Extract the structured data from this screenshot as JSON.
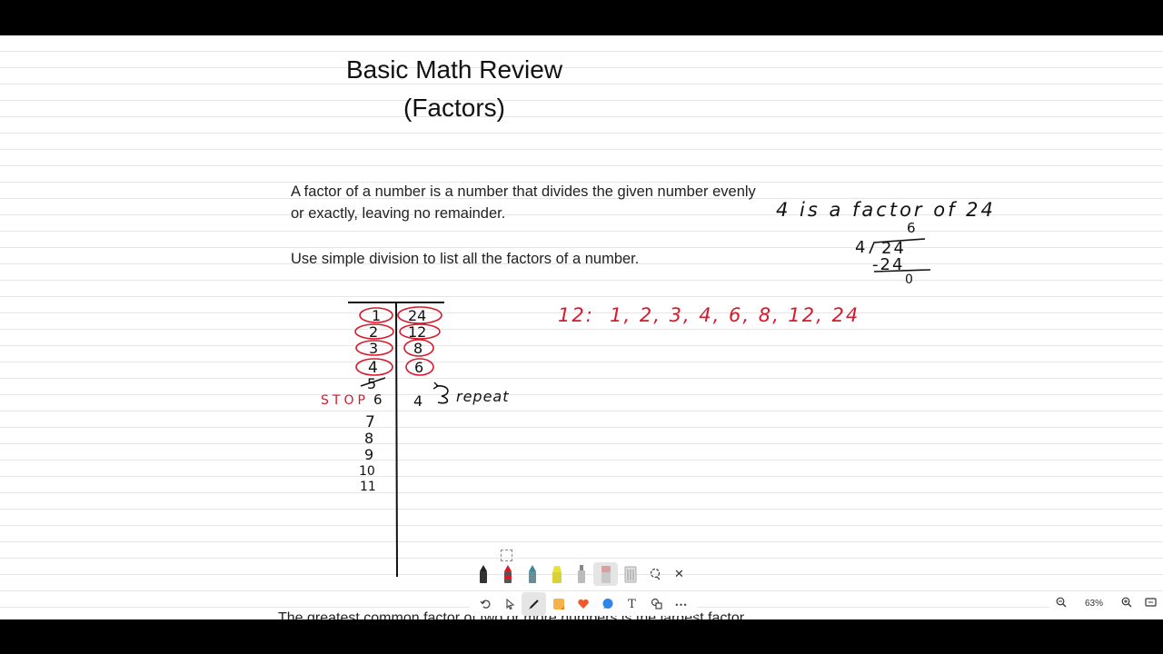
{
  "document": {
    "title_line1": "Basic Math Review",
    "title_line2": "(Factors)",
    "paragraph1": "A factor of a number is a number that divides the given number evenly or exactly, leaving no remainder.",
    "paragraph2": "Use simple division to list all the factors of a number.",
    "bottom_text": "The greatest common factor of two or more numbers is the largest factor"
  },
  "handwriting": {
    "statement": "4 is a factor of 24",
    "division": {
      "quotient": "6",
      "divisor": "4",
      "dividend": "24",
      "subtrahend": "-24",
      "remainder": "0"
    },
    "factor_list": "12:  1, 2, 3, 4, 6, 8, 12, 24",
    "table_header_left": "1",
    "table_header_right": "24",
    "left_column": [
      "2",
      "3",
      "4",
      "5",
      "6",
      "7",
      "8",
      "9",
      "10",
      "11"
    ],
    "right_column": [
      "12",
      "8",
      "6",
      "4"
    ],
    "stop_label": "STOP",
    "repeat_label": "repeat",
    "ink_colors": {
      "black": "#111111",
      "red": "#d6192b"
    }
  },
  "toolbar": {
    "pens": [
      {
        "name": "black-pen",
        "color": "#222222"
      },
      {
        "name": "red-pen",
        "color": "#d6192b"
      },
      {
        "name": "teal-pen",
        "color": "#3b8a9a"
      },
      {
        "name": "yellow-highlighter",
        "color": "#e8e23a"
      },
      {
        "name": "grey-pencil",
        "color": "#9e9e9e"
      },
      {
        "name": "eraser",
        "color": "#d9a0a0"
      },
      {
        "name": "ruler",
        "color": "#bbbbbb"
      }
    ],
    "undo_icon": "undo-icon",
    "select_icon": "pointer-icon",
    "draw_icon": "pen-icon",
    "sticky_note_color": "#f6b24a",
    "heart_color": "#f05a2a",
    "comment_color": "#2f86e8",
    "text_tool": "T",
    "more": "⋯",
    "close": "✕"
  },
  "zoom": {
    "value": "63%"
  }
}
